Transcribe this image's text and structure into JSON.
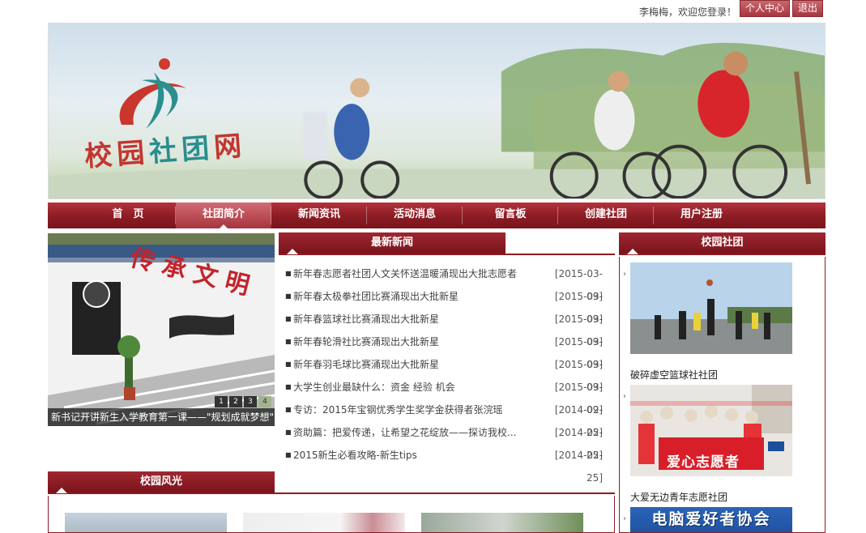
{
  "topbar": {
    "welcome": "李梅梅，欢迎您登录！",
    "center_label": "个人中心",
    "logout_label": "退出"
  },
  "banner": {
    "logo_text": [
      "校",
      "园",
      "社",
      "团",
      "网"
    ]
  },
  "nav": {
    "items": [
      "首　页",
      "社团简介",
      "新闻资讯",
      "活动消息",
      "留言板",
      "创建社团",
      "用户注册"
    ],
    "active_index": 1
  },
  "slider": {
    "caption": "新书记开讲新生入学教育第一课——\"规划成就梦想\"",
    "dots": [
      "1",
      "2",
      "3",
      "4"
    ],
    "active_dot": 4
  },
  "news": {
    "heading": "最新新闻",
    "items": [
      {
        "title": "新年春志愿者社团人文关怀送温暖涌现出大批志愿者",
        "date": "[2015-03-09]"
      },
      {
        "title": "新年春太极拳社团比赛涌现出大批新星",
        "date": "[2015-03-09]"
      },
      {
        "title": "新年春篮球社比赛涌现出大批新星",
        "date": "[2015-03-09]"
      },
      {
        "title": "新年春轮滑社比赛涌现出大批新星",
        "date": "[2015-03-09]"
      },
      {
        "title": "新年春羽毛球比赛涌现出大批新星",
        "date": "[2015-03-09]"
      },
      {
        "title": "大学生创业最缺什么：资金 经验 机会",
        "date": "[2015-03-09]"
      },
      {
        "title": "专访：2015年宝钢优秀学生奖学金获得者张浣瑶",
        "date": "[2014-02-25]"
      },
      {
        "title": "资助篇：把爱传递，让希望之花绽放——探访我校...",
        "date": "[2014-02-25]"
      },
      {
        "title": "2015新生必看攻略-新生tips",
        "date": "[2014-02-25]"
      }
    ]
  },
  "clubs": {
    "heading": "校园社团",
    "items": [
      {
        "name": "破碎虚空篮球社社团"
      },
      {
        "name": "大爱无边青年志愿社团",
        "banner_text": "爱心志愿者"
      },
      {
        "name": "",
        "banner_text": "电脑爱好者协会"
      }
    ]
  },
  "scenery": {
    "heading": "校园风光"
  },
  "slider_art": {
    "text": "传承文明"
  },
  "colors": {
    "brand": "#8b1c24",
    "accent": "#b3323b"
  }
}
